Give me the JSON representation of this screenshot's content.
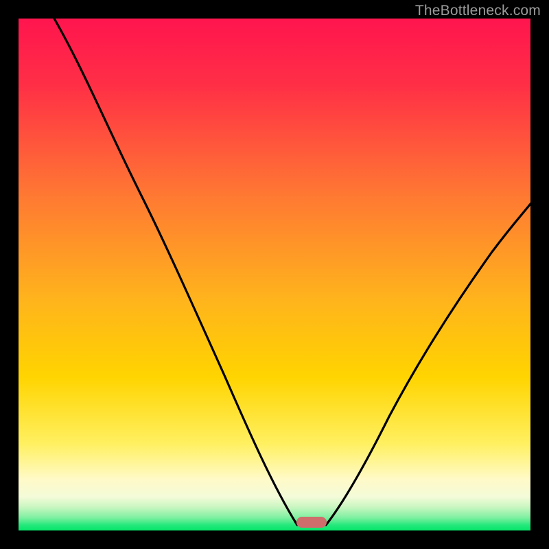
{
  "watermark": "TheBottleneck.com",
  "colors": {
    "frame": "#000000",
    "gradient_top": "#ff154e",
    "gradient_mid_upper": "#ff8c2f",
    "gradient_mid": "#ffd400",
    "gradient_lower": "#fff9c0",
    "gradient_bottom": "#06e66a",
    "curve": "#000000",
    "marker": "#cf6d6c"
  },
  "chart_data": {
    "type": "line",
    "title": "",
    "xlabel": "",
    "ylabel": "",
    "xlim": [
      0,
      100
    ],
    "ylim": [
      0,
      100
    ],
    "series": [
      {
        "name": "left-branch",
        "x": [
          7,
          12,
          18,
          24,
          28,
          33,
          38,
          42,
          46,
          49,
          52,
          54.5
        ],
        "values": [
          100,
          90,
          78,
          66,
          58,
          48,
          37,
          27,
          17,
          9,
          3,
          0.5
        ]
      },
      {
        "name": "right-branch",
        "x": [
          60,
          63,
          67,
          72,
          78,
          85,
          92,
          100
        ],
        "values": [
          0.5,
          4,
          11,
          21,
          33,
          45,
          55,
          64
        ]
      }
    ],
    "marker": {
      "x_center": 57.2,
      "y": 0.5,
      "width": 5.5,
      "height": 2.1
    },
    "gradient_stops_pct": [
      0,
      35,
      65,
      86,
      92,
      96,
      99,
      100
    ]
  }
}
